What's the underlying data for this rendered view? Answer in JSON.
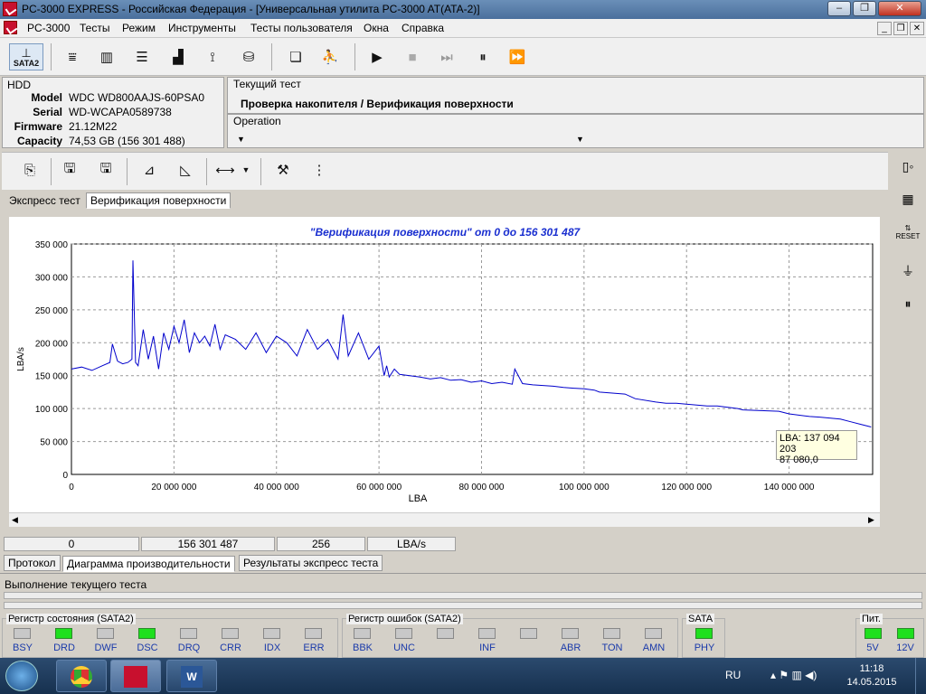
{
  "window": {
    "title": "PC-3000 EXPRESS - Российская Федерация - [Универсальная утилита PC-3000 AT(ATA-2)]"
  },
  "menu": [
    "PC-3000",
    "Тесты",
    "Режим",
    "Инструменты",
    "Тесты пользователя",
    "Окна",
    "Справка"
  ],
  "toolbar": {
    "sata_label": "SATA2"
  },
  "hdd": {
    "section": "HDD",
    "model_label": "Model",
    "model": "WDC WD800AAJS-60PSA0",
    "serial_label": "Serial",
    "serial": "WD-WCAPA0589738",
    "firmware_label": "Firmware",
    "firmware": "21.12M22",
    "capacity_label": "Capacity",
    "capacity": "74,53 GB (156 301 488)"
  },
  "current_test": {
    "label": "Текущий тест",
    "value": "Проверка накопителя / Верификация поверхности",
    "operation_label": "Operation"
  },
  "test_tabs": [
    "Экспресс тест",
    "Верификация поверхности"
  ],
  "bottom_tabs": [
    "Протокол",
    "Диаграмма производительности",
    "Результаты экспресс теста"
  ],
  "status_cells": [
    "0",
    "156 301 487",
    "256",
    "LBA/s"
  ],
  "progress_label": "Выполнение текущего теста",
  "tooltip": {
    "line1": "LBA: 137 094 203",
    "line2": "87 080,0"
  },
  "status_register": {
    "title": "Регистр состояния (SATA2)",
    "leds": [
      {
        "name": "BSY",
        "on": false
      },
      {
        "name": "DRD",
        "on": true
      },
      {
        "name": "DWF",
        "on": false
      },
      {
        "name": "DSC",
        "on": true
      },
      {
        "name": "DRQ",
        "on": false
      },
      {
        "name": "CRR",
        "on": false
      },
      {
        "name": "IDX",
        "on": false
      },
      {
        "name": "ERR",
        "on": false
      }
    ]
  },
  "error_register": {
    "title": "Регистр ошибок (SATA2)",
    "leds": [
      {
        "name": "BBK",
        "on": false
      },
      {
        "name": "UNC",
        "on": false
      },
      {
        "name": "",
        "on": false
      },
      {
        "name": "INF",
        "on": false
      },
      {
        "name": "",
        "on": false
      },
      {
        "name": "ABR",
        "on": false
      },
      {
        "name": "TON",
        "on": false
      },
      {
        "name": "AMN",
        "on": false
      }
    ]
  },
  "sata": {
    "title": "SATA",
    "led": "PHY",
    "on": true
  },
  "power": {
    "title": "Пит.",
    "v5": "5V",
    "v12": "12V"
  },
  "taskbar": {
    "lang": "RU",
    "time": "11:18",
    "date": "14.05.2015"
  },
  "chart_data": {
    "type": "line",
    "title": "\"Верификация поверхности\" от 0 до 156 301 487",
    "xlabel": "LBA",
    "ylabel": "LBA/s",
    "xlim": [
      0,
      156301487
    ],
    "ylim": [
      0,
      350000
    ],
    "xticks": [
      "0",
      "20 000 000",
      "40 000 000",
      "60 000 000",
      "80 000 000",
      "100 000 000",
      "120 000 000",
      "140 000 000"
    ],
    "yticks": [
      "0",
      "50 000",
      "100 000",
      "150 000",
      "200 000",
      "250 000",
      "300 000",
      "350 000"
    ],
    "grid": true,
    "series": [
      {
        "color": "#0000cc",
        "x": [
          0,
          2000000,
          4000000,
          6000000,
          7500000,
          8000000,
          9000000,
          10000000,
          11000000,
          11800000,
          12000000,
          12500000,
          13000000,
          14000000,
          15000000,
          16000000,
          17000000,
          18000000,
          19000000,
          20000000,
          21000000,
          22000000,
          23000000,
          24000000,
          25000000,
          26000000,
          27000000,
          28000000,
          29000000,
          30000000,
          32000000,
          34000000,
          36000000,
          38000000,
          40000000,
          42000000,
          44000000,
          46000000,
          48000000,
          50000000,
          52000000,
          53000000,
          54000000,
          56000000,
          58000000,
          60000000,
          61000000,
          61500000,
          62000000,
          63000000,
          64000000,
          66000000,
          68000000,
          70000000,
          72000000,
          74000000,
          76000000,
          78000000,
          80000000,
          82000000,
          84000000,
          86000000,
          86500000,
          88000000,
          90000000,
          92000000,
          94000000,
          96000000,
          98000000,
          100000000,
          102000000,
          103000000,
          108000000,
          110000000,
          114000000,
          116000000,
          118000000,
          124000000,
          126000000,
          130000000,
          131000000,
          138000000,
          140000000,
          144000000,
          146000000,
          150000000,
          152000000,
          154000000,
          156000000
        ],
        "y": [
          160000,
          163000,
          158000,
          165000,
          170000,
          198000,
          172000,
          168000,
          170000,
          175000,
          325000,
          170000,
          165000,
          220000,
          175000,
          210000,
          160000,
          215000,
          190000,
          225000,
          200000,
          235000,
          185000,
          215000,
          200000,
          210000,
          195000,
          228000,
          190000,
          212000,
          205000,
          190000,
          215000,
          185000,
          210000,
          200000,
          180000,
          220000,
          190000,
          205000,
          175000,
          243000,
          180000,
          215000,
          175000,
          195000,
          150000,
          165000,
          148000,
          160000,
          152000,
          150000,
          148000,
          145000,
          147000,
          143000,
          144000,
          140000,
          142000,
          138000,
          140000,
          137000,
          160000,
          138000,
          136000,
          135000,
          134000,
          132000,
          131000,
          130000,
          128000,
          125000,
          122000,
          115000,
          110000,
          108000,
          108000,
          104000,
          104000,
          100000,
          98000,
          96000,
          92000,
          88000,
          87000,
          84000,
          80000,
          76000,
          72000
        ]
      }
    ]
  }
}
